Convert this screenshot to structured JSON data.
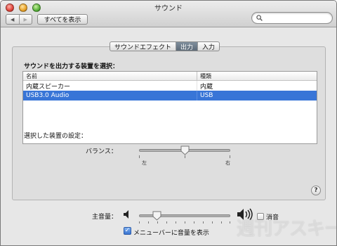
{
  "window": {
    "title": "サウンド"
  },
  "toolbar": {
    "back_glyph": "◀",
    "forward_glyph": "▶",
    "show_all_label": "すべてを表示",
    "search_placeholder": ""
  },
  "tabs": [
    {
      "label": "サウンドエフェクト",
      "active": false
    },
    {
      "label": "出力",
      "active": true
    },
    {
      "label": "入力",
      "active": false
    }
  ],
  "output": {
    "section_label": "サウンドを出力する装置を選択：",
    "columns": {
      "name": "名前",
      "type": "種類"
    },
    "devices": [
      {
        "name": "内蔵スピーカー",
        "type": "内蔵",
        "selected": false
      },
      {
        "name": "USB3.0 Audio",
        "type": "USB",
        "selected": true
      }
    ],
    "settings_label": "選択した装置の設定：",
    "balance": {
      "label": "バランス：",
      "left": "左",
      "right": "右",
      "value": 0.5
    }
  },
  "help_label": "?",
  "volume": {
    "label": "主音量：",
    "value": 0.2,
    "mute_label": "消音",
    "muted": false
  },
  "menubar": {
    "label": "メニューバーに音量を表示",
    "checked": true,
    "check_glyph": "✓"
  },
  "watermark": "週刊アスキー",
  "colors": {
    "selection": "#3875d7",
    "active_tab": "#6b7a88"
  }
}
